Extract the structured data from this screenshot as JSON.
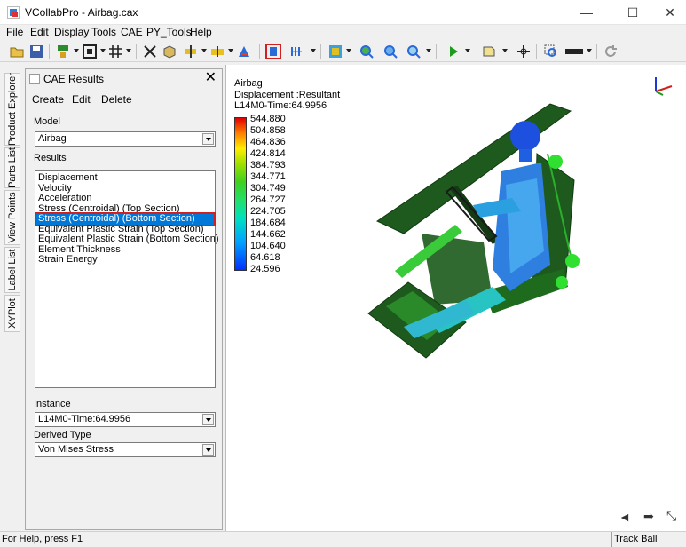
{
  "window": {
    "title": "VCollabPro - Airbag.cax",
    "minimize": "—",
    "maximize": "☐",
    "close": "✕"
  },
  "menu": [
    "File",
    "Edit",
    "Display",
    "Tools",
    "CAE",
    "PY_Tools",
    "Help"
  ],
  "toolbar": {
    "icons": [
      "open-icon",
      "save-icon",
      "model-tree-icon",
      "fit-view-icon",
      "grid-icon",
      "explode-icon",
      "cube-view-icon",
      "section-icon",
      "markup-icon",
      "cae-results-icon",
      "legend-icon",
      "color-plot-icon",
      "zoom-in-icon",
      "zoom-out-icon",
      "zoom-window-icon",
      "play-icon",
      "label-icon",
      "pan-icon",
      "probe-icon",
      "display-mode-icon",
      "refresh-icon"
    ]
  },
  "side_tabs": [
    "Product Explorer",
    "Parts List",
    "View Points",
    "Label List",
    "XYPlot"
  ],
  "panel": {
    "title": "CAE Results",
    "close": "✕",
    "actions": [
      "Create",
      "Edit",
      "Delete"
    ],
    "model_label": "Model",
    "model_value": "Airbag",
    "results_label": "Results",
    "results": [
      "Displacement",
      "Velocity",
      "Acceleration",
      "Stress (Centroidal) (Top Section)",
      "Stress (Centroidal) (Bottom Section)",
      "Equivalent Plastic Strain (Top Section)",
      "Equivalent Plastic Strain (Bottom Section)",
      "Element Thickness",
      "Strain Energy"
    ],
    "selected_index": 4,
    "instance_label": "Instance",
    "instance_value": "L14M0-Time:64.9956",
    "derived_label": "Derived Type",
    "derived_value": "Von Mises Stress"
  },
  "viewport": {
    "model_name": "Airbag",
    "result_line": "Displacement :Resultant",
    "instance_line": "L14M0-Time:64.9956",
    "legend": [
      "544.880",
      "504.858",
      "464.836",
      "424.814",
      "384.793",
      "344.771",
      "304.749",
      "264.727",
      "224.705",
      "184.684",
      "144.662",
      "104.640",
      "64.618",
      "24.596"
    ],
    "nav": {
      "back": "◄",
      "forward": "➡",
      "expand": "⤡"
    }
  },
  "status": {
    "help": "For Help, press F1",
    "mode": "Track Ball"
  },
  "colors": {
    "selection": "#0078d7",
    "highlight_border": "#d02020",
    "vehicle_green": "#1e6b1e",
    "dummy_blue": "#2f7fe0"
  }
}
